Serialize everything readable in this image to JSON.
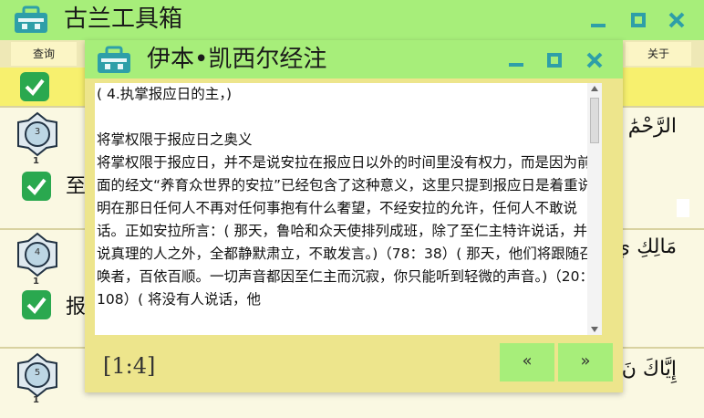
{
  "app": {
    "title": "古兰工具箱"
  },
  "menu": {
    "query_label": "查询",
    "about_label": "关于"
  },
  "rows": [
    {
      "number": "3",
      "sub": "1",
      "text": "至",
      "arabic": "الرَّحْمَٰ"
    },
    {
      "number": "4",
      "sub": "1",
      "text": "报",
      "arabic": "مَالِكِ يَ"
    },
    {
      "number": "5",
      "sub": "1",
      "text": "",
      "arabic": "إِيَّاكَ نَ"
    }
  ],
  "dialog": {
    "title": "伊本•凯西尔经注",
    "reference": "[1:4]",
    "prev_label": "«",
    "next_label": "»",
    "lines": [
      "( 4.执掌报应日的主，)",
      "",
      "将掌权限于报应日之奥义",
      "将掌权限于报应日，并不是说安拉在报应日以外的时间里没有权力，而是因为前面的经文“养育众世界的安拉”已经包含了这种意义，这里只提到报应日是着重说明在那日任何人不再对任何事抱有什么奢望，不经安拉的允许，任何人不敢说话。正如安拉所言：( 那天，鲁哈和众天使排列成班，除了至仁主特许说话，并说真理的人之外，全都静默肃立，不敢发言。)（78：38）( 那天，他们将跟随召唤者，百依百顺。一切声音都因至仁主而沉寂，你只能听到轻微的声音。)（20：108）( 将没有人说话，他"
    ]
  },
  "colors": {
    "titlebar": "#a7ee7a",
    "background": "#eee8b6",
    "toolbar": "#f7f06e",
    "accent_green": "#2aa84f",
    "icon_teal": "#2e9fa8"
  }
}
